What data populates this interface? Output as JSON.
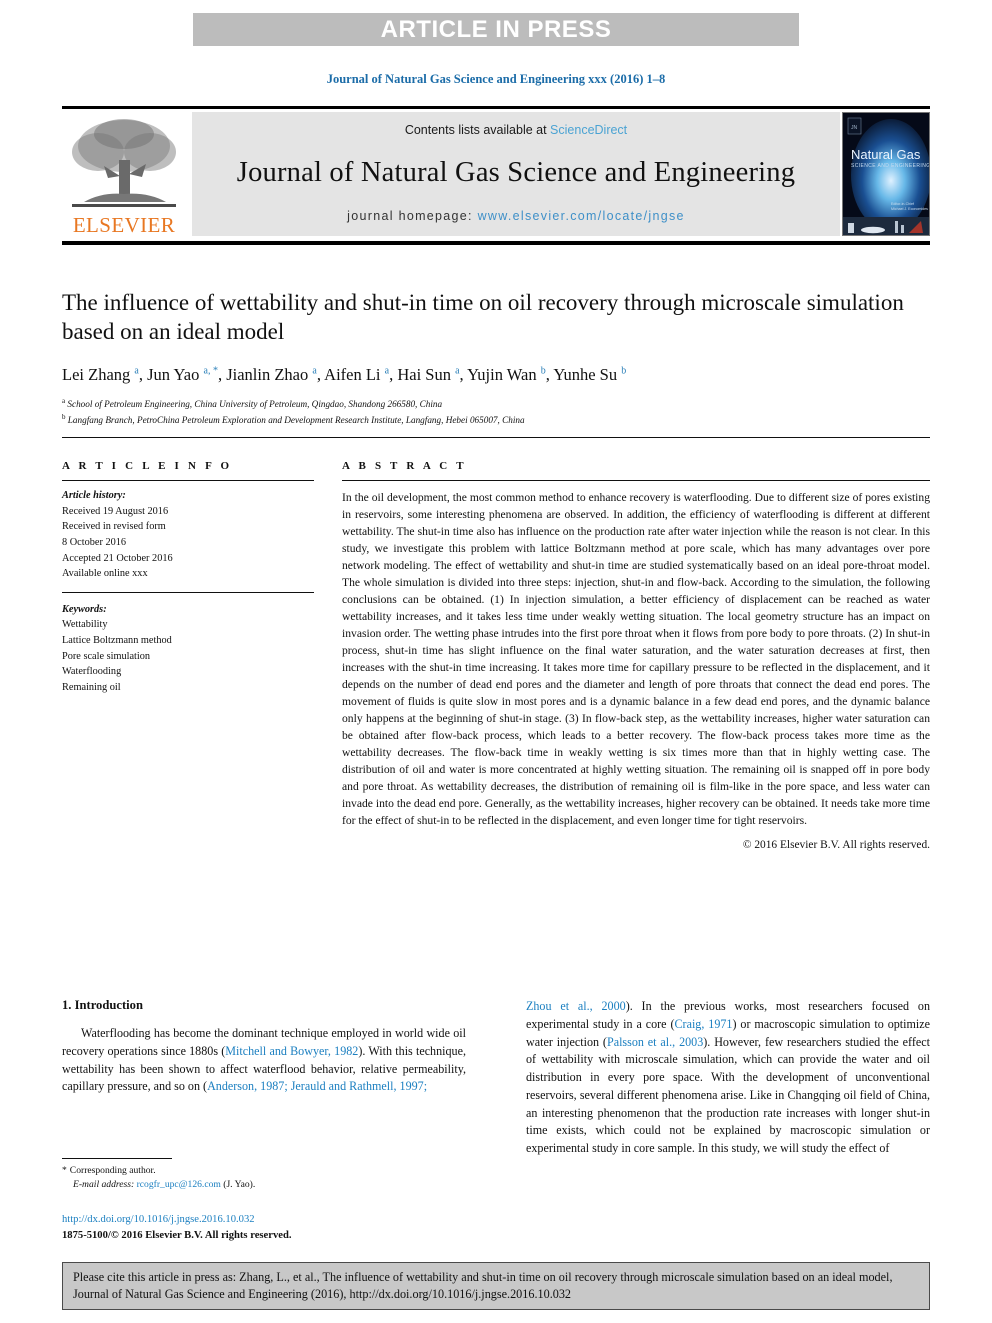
{
  "banner": {
    "text": "ARTICLE IN PRESS"
  },
  "running_head": {
    "text": "Journal of Natural Gas Science and Engineering xxx (2016) 1–8"
  },
  "masthead": {
    "contents_prefix": "Contents lists available at ",
    "contents_link": "ScienceDirect",
    "journal_name": "Journal of Natural Gas Science and Engineering",
    "homepage_prefix": "journal homepage: ",
    "homepage_url": "www.elsevier.com/locate/jngse",
    "publisher_word": "ELSEVIER",
    "cover_title_main": "Natural Gas",
    "cover_title_sub": "SCIENCE AND ENGINEERING",
    "accent_orange": "#E87722",
    "link_blue": "#3f90c8"
  },
  "article": {
    "title": "The influence of wettability and shut-in time on oil recovery through microscale simulation based on an ideal model",
    "authors_html": "Lei Zhang <sup>a</sup>, Jun Yao <sup>a, *</sup>, Jianlin Zhao <sup>a</sup>, Aifen Li <sup>a</sup>, Hai Sun <sup>a</sup>, Yujin Wan <sup>b</sup>, Yunhe Su <sup>b</sup>",
    "affiliation_a": "School of Petroleum Engineering, China University of Petroleum, Qingdao, Shandong 266580, China",
    "affiliation_b": "Langfang Branch, PetroChina Petroleum Exploration and Development Research Institute, Langfang, Hebei 065007, China"
  },
  "article_info": {
    "heading": "A R T I C L E   I N F O",
    "history_label": "Article history:",
    "history_lines": [
      "Received 19 August 2016",
      "Received in revised form",
      "8 October 2016",
      "Accepted 21 October 2016",
      "Available online xxx"
    ],
    "keywords_label": "Keywords:",
    "keywords": [
      "Wettability",
      "Lattice Boltzmann method",
      "Pore scale simulation",
      "Waterflooding",
      "Remaining oil"
    ]
  },
  "abstract": {
    "heading": "A B S T R A C T",
    "text": "In the oil development, the most common method to enhance recovery is waterflooding. Due to different size of pores existing in reservoirs, some interesting phenomena are observed. In addition, the efficiency of waterflooding is different at different wettability. The shut-in time also has influence on the production rate after water injection while the reason is not clear. In this study, we investigate this problem with lattice Boltzmann method at pore scale, which has many advantages over pore network modeling. The effect of wettability and shut-in time are studied systematically based on an ideal pore-throat model. The whole simulation is divided into three steps: injection, shut-in and flow-back. According to the simulation, the following conclusions can be obtained. (1) In injection simulation, a better efficiency of displacement can be reached as water wettability increases, and it takes less time under weakly wetting situation. The local geometry structure has an impact on invasion order. The wetting phase intrudes into the first pore throat when it flows from pore body to pore throats. (2) In shut-in process, shut-in time has slight influence on the final water saturation, and the water saturation decreases at first, then increases with the shut-in time increasing. It takes more time for capillary pressure to be reflected in the displacement, and it depends on the number of dead end pores and the diameter and length of pore throats that connect the dead end pores. The movement of fluids is quite slow in most pores and is a dynamic balance in a few dead end pores, and the dynamic balance only happens at the beginning of shut-in stage. (3) In flow-back step, as the wettability increases, higher water saturation can be obtained after flow-back process, which leads to a better recovery. The flow-back process takes more time as the wettability decreases. The flow-back time in weakly wetting is six times more than that in highly wetting case. The distribution of oil and water is more concentrated at highly wetting situation. The remaining oil is snapped off in pore body and pore throat. As wettability decreases, the distribution of remaining oil is film-like in the pore space, and less water can invade into the dead end pore. Generally, as the wettability increases, higher recovery can be obtained. It needs take more time for the effect of shut-in to be reflected in the displacement, and even longer time for tight reservoirs.",
    "copyright": "© 2016 Elsevier B.V. All rights reserved."
  },
  "body": {
    "section_heading": "1. Introduction",
    "left_segments": [
      {
        "t": "Waterflooding has become the dominant technique employed in world wide oil recovery operations since 1880s (",
        "link": false
      },
      {
        "t": "Mitchell and Bowyer, 1982",
        "link": true
      },
      {
        "t": "). With this technique, wettability has been shown to affect waterflood behavior, relative permeability, capillary pressure, and so on (",
        "link": false
      },
      {
        "t": "Anderson, 1987; Jerauld and Rathmell, 1997;",
        "link": true
      }
    ],
    "right_segments": [
      {
        "t": "Zhou et al., 2000",
        "link": true
      },
      {
        "t": "). In the previous works, most researchers focused on experimental study in a core (",
        "link": false
      },
      {
        "t": "Craig, 1971",
        "link": true
      },
      {
        "t": ") or macroscopic simulation to optimize water injection (",
        "link": false
      },
      {
        "t": "Palsson et al., 2003",
        "link": true
      },
      {
        "t": "). However, few researchers studied the effect of wettability with microscale simulation, which can provide the water and oil distribution in every pore space. With the development of unconventional reservoirs, several different phenomena arise. Like in Changqing oil field of China, an interesting phenomenon that the production rate increases with longer shut-in time exists, which could not be explained by macroscopic simulation or experimental study in core sample. In this study, we will study the effect of",
        "link": false
      }
    ]
  },
  "footnote": {
    "star": "*",
    "corresponding": "Corresponding author.",
    "email_label": "E-mail address:",
    "email": "rcogfr_upc@126.com",
    "email_owner": "(J. Yao).",
    "doi_url": "http://dx.doi.org/10.1016/j.jngse.2016.10.032",
    "issn_line": "1875-5100/© 2016 Elsevier B.V. All rights reserved."
  },
  "cite_box": {
    "text": "Please cite this article in press as: Zhang, L., et al., The influence of wettability and shut-in time on oil recovery through microscale simulation based on an ideal model, Journal of Natural Gas Science and Engineering (2016), http://dx.doi.org/10.1016/j.jngse.2016.10.032"
  }
}
